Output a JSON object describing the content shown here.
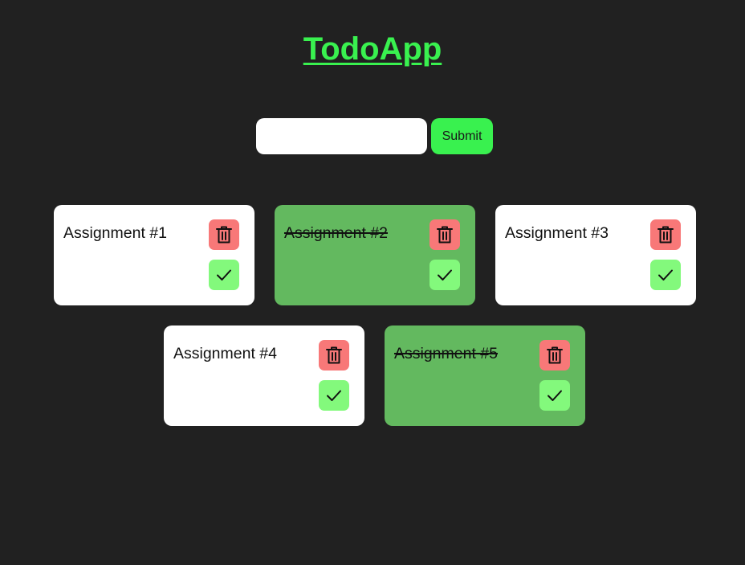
{
  "header": {
    "title": "TodoApp"
  },
  "form": {
    "input_value": "",
    "input_placeholder": "",
    "submit_label": "Submit"
  },
  "colors": {
    "background": "#212121",
    "accent": "#39f14f",
    "card_pending": "#ffffff",
    "card_done": "#63b95f",
    "delete_button": "#f87878",
    "complete_button": "#83f97c"
  },
  "todos": [
    {
      "text": "Assignment #1",
      "completed": false,
      "delete_icon": "trash-icon",
      "complete_icon": "check-icon"
    },
    {
      "text": "Assignment #2",
      "completed": true,
      "delete_icon": "trash-icon",
      "complete_icon": "check-icon"
    },
    {
      "text": "Assignment #3",
      "completed": false,
      "delete_icon": "trash-icon",
      "complete_icon": "check-icon"
    },
    {
      "text": "Assignment #4",
      "completed": false,
      "delete_icon": "trash-icon",
      "complete_icon": "check-icon"
    },
    {
      "text": "Assignment #5",
      "completed": true,
      "delete_icon": "trash-icon",
      "complete_icon": "check-icon"
    }
  ]
}
